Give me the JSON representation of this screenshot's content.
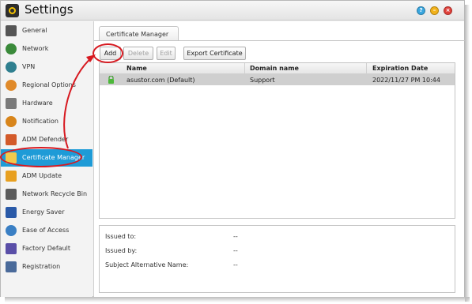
{
  "window": {
    "title": "Settings",
    "buttons": {
      "help": "?",
      "minimize": "–",
      "close": "×"
    }
  },
  "sidebar": {
    "items": [
      {
        "label": "General",
        "icon": "general-icon"
      },
      {
        "label": "Network",
        "icon": "network-icon"
      },
      {
        "label": "VPN",
        "icon": "vpn-icon"
      },
      {
        "label": "Regional Options",
        "icon": "regional-options-icon"
      },
      {
        "label": "Hardware",
        "icon": "hardware-icon"
      },
      {
        "label": "Notification",
        "icon": "notification-icon"
      },
      {
        "label": "ADM Defender",
        "icon": "adm-defender-icon"
      },
      {
        "label": "Certificate Manager",
        "icon": "certificate-icon",
        "active": true
      },
      {
        "label": "ADM Update",
        "icon": "adm-update-icon"
      },
      {
        "label": "Network Recycle Bin",
        "icon": "recycle-bin-icon"
      },
      {
        "label": "Energy Saver",
        "icon": "energy-saver-icon"
      },
      {
        "label": "Ease of Access",
        "icon": "ease-of-access-icon"
      },
      {
        "label": "Factory Default",
        "icon": "factory-default-icon"
      },
      {
        "label": "Registration",
        "icon": "registration-icon"
      }
    ]
  },
  "main": {
    "tab": "Certificate Manager",
    "toolbar": {
      "add": "Add",
      "delete": "Delete",
      "edit": "Edit",
      "export": "Export Certificate"
    },
    "table": {
      "headers": [
        "Name",
        "Domain name",
        "Expiration Date"
      ],
      "rows": [
        {
          "name": "asustor.com (Default)",
          "domain": "Support",
          "expiration": "2022/11/27 PM 10:44"
        }
      ]
    },
    "details": {
      "issued_to_label": "Issued to:",
      "issued_to_value": "--",
      "issued_by_label": "Issued by:",
      "issued_by_value": "--",
      "san_label": "Subject Alternative Name:",
      "san_value": "--"
    }
  },
  "colors": {
    "accent": "#1e9bd7",
    "annotation": "#d71920",
    "selected_row": "#cfcfcf"
  }
}
